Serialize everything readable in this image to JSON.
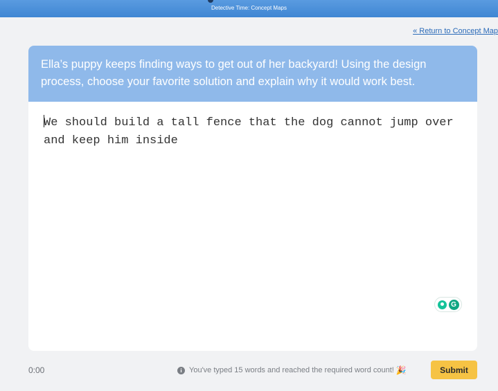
{
  "header": {
    "title": "Detective Time: Concept Maps"
  },
  "nav": {
    "return_link": "« Return to Concept Map"
  },
  "prompt": {
    "text": "Ella’s puppy keeps finding ways to get out of her backyard! Using the design process, choose your favorite solution and explain why it would work best."
  },
  "answer": {
    "value": "We should build a tall fence that the dog cannot jump over and keep him inside"
  },
  "footer": {
    "timer": "0:00",
    "info_message": "You've typed 15 words and reached the required word count!",
    "submit_label": "Submit"
  },
  "icons": {
    "info": "info-icon",
    "party": "party-popper-icon",
    "grammarly_bulb": "lightbulb-icon",
    "grammarly_logo": "grammarly-icon"
  },
  "colors": {
    "top_bar": "#4a90d9",
    "prompt_bg": "#8fb9ea",
    "submit_bg": "#f6c344",
    "link": "#2a6ab8"
  }
}
